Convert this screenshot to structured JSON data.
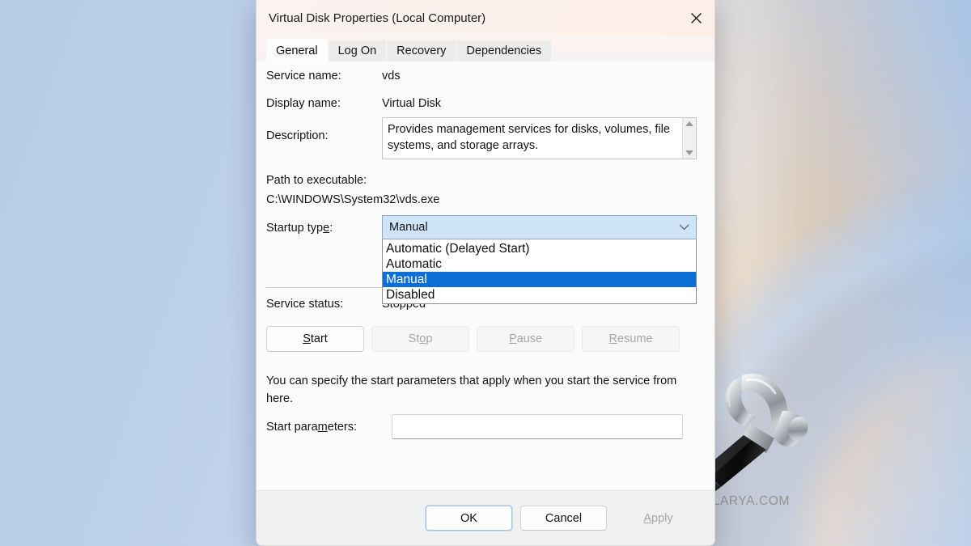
{
  "window": {
    "title": "Virtual Disk Properties (Local Computer)",
    "close_icon": "close-icon"
  },
  "tabs": [
    {
      "label": "General",
      "active": true
    },
    {
      "label": "Log On",
      "active": false
    },
    {
      "label": "Recovery",
      "active": false
    },
    {
      "label": "Dependencies",
      "active": false
    }
  ],
  "general": {
    "service_name_label": "Service name:",
    "service_name_value": "vds",
    "display_name_label": "Display name:",
    "display_name_value": "Virtual Disk",
    "description_label": "Description:",
    "description_value": "Provides management services for disks, volumes, file systems, and storage arrays.",
    "path_label": "Path to executable:",
    "path_value": "C:\\WINDOWS\\System32\\vds.exe",
    "startup_type_label": "Startup type:",
    "startup_type_value": "Manual",
    "startup_type_options": [
      {
        "label": "Automatic (Delayed Start)",
        "selected": false
      },
      {
        "label": "Automatic",
        "selected": false
      },
      {
        "label": "Manual",
        "selected": true
      },
      {
        "label": "Disabled",
        "selected": false
      }
    ],
    "service_status_label": "Service status:",
    "service_status_value": "Stopped",
    "actions": [
      {
        "label": "Start",
        "enabled": true
      },
      {
        "label": "Stop",
        "enabled": false
      },
      {
        "label": "Pause",
        "enabled": false
      },
      {
        "label": "Resume",
        "enabled": false
      }
    ],
    "helper_text": "You can specify the start parameters that apply when you start the service from here.",
    "start_parameters_label": "Start parameters:",
    "start_parameters_value": ""
  },
  "footer": {
    "ok_label": "OK",
    "cancel_label": "Cancel",
    "apply_label": "Apply"
  },
  "watermark": "KAPILARYA.COM",
  "colors": {
    "selection_blue": "#0c6fd6",
    "combo_fill": "#cfe4f7",
    "focus_border": "#9fc3e0",
    "wallpaper_blue": "#b9cde8",
    "wallpaper_warm": "#f7c48e"
  }
}
